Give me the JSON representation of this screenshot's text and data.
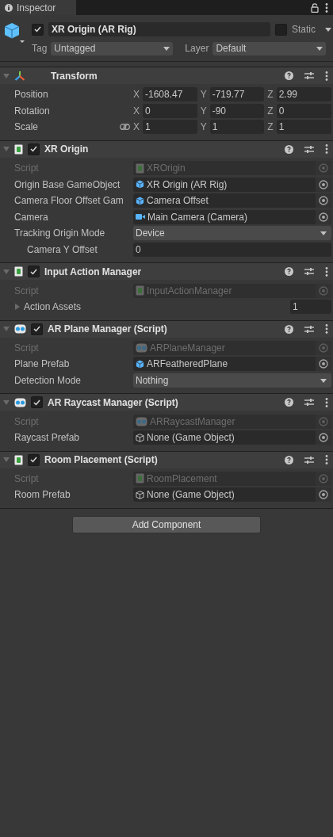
{
  "tab": {
    "title": "Inspector",
    "selected": true
  },
  "object": {
    "active": true,
    "name": "XR Origin (AR Rig)",
    "static": false,
    "static_label": "Static",
    "tag_label": "Tag",
    "tag": "Untagged",
    "layer_label": "Layer",
    "layer": "Default"
  },
  "components": [
    {
      "kind": "transform",
      "title": "Transform",
      "expanded": true,
      "properties": [
        {
          "kind": "vector3",
          "label": "Position",
          "linked": false,
          "values": [
            {
              "axis": "X",
              "value": "-1608.47"
            },
            {
              "axis": "Y",
              "value": "-719.77"
            },
            {
              "axis": "Z",
              "value": "2.99"
            }
          ]
        },
        {
          "kind": "vector3",
          "label": "Rotation",
          "linked": false,
          "values": [
            {
              "axis": "X",
              "value": "0"
            },
            {
              "axis": "Y",
              "value": "-90"
            },
            {
              "axis": "Z",
              "value": "0"
            }
          ]
        },
        {
          "kind": "vector3",
          "label": "Scale",
          "linked": true,
          "values": [
            {
              "axis": "X",
              "value": "1"
            },
            {
              "axis": "Y",
              "value": "1"
            },
            {
              "axis": "Z",
              "value": "1"
            }
          ]
        }
      ]
    },
    {
      "kind": "script",
      "title": "XR Origin",
      "enabled": true,
      "expanded": true,
      "properties": [
        {
          "kind": "script",
          "label": "Script",
          "value": "XROrigin"
        },
        {
          "kind": "prefab",
          "label": "Origin Base GameObject",
          "value": "XR Origin (AR Rig)"
        },
        {
          "kind": "prefab",
          "label": "Camera Floor Offset Gam",
          "value": "Camera Offset"
        },
        {
          "kind": "camera",
          "label": "Camera",
          "value": "Main Camera (Camera)"
        },
        {
          "kind": "enum",
          "label": "Tracking Origin Mode",
          "value": "Device"
        },
        {
          "kind": "text",
          "label": "Camera Y Offset",
          "value": "0"
        }
      ]
    },
    {
      "kind": "script",
      "title": "Input Action Manager",
      "enabled": true,
      "expanded": true,
      "properties": [
        {
          "kind": "script",
          "label": "Script",
          "value": "InputActionManager"
        },
        {
          "kind": "foldout",
          "label": "Action Assets",
          "expanded": false,
          "value": "1"
        }
      ]
    },
    {
      "kind": "ar",
      "title": "AR Plane Manager (Script)",
      "enabled": true,
      "expanded": true,
      "properties": [
        {
          "kind": "script",
          "label": "Script",
          "value": "ARPlaneManager"
        },
        {
          "kind": "prefab",
          "label": "Plane Prefab",
          "value": "ARFeatheredPlane"
        },
        {
          "kind": "enum",
          "label": "Detection Mode",
          "value": "Nothing"
        }
      ]
    },
    {
      "kind": "ar",
      "title": "AR Raycast Manager (Script)",
      "enabled": true,
      "expanded": true,
      "properties": [
        {
          "kind": "script",
          "label": "Script",
          "value": "ARRaycastManager"
        },
        {
          "kind": "empty",
          "label": "Raycast Prefab",
          "value": "None (Game Object)"
        }
      ]
    },
    {
      "kind": "script",
      "title": "Room Placement (Script)",
      "enabled": true,
      "expanded": true,
      "properties": [
        {
          "kind": "script",
          "label": "Script",
          "value": "RoomPlacement"
        },
        {
          "kind": "empty",
          "label": "Room Prefab",
          "value": "None (Game Object)"
        }
      ]
    }
  ],
  "add_button": "Add Component"
}
